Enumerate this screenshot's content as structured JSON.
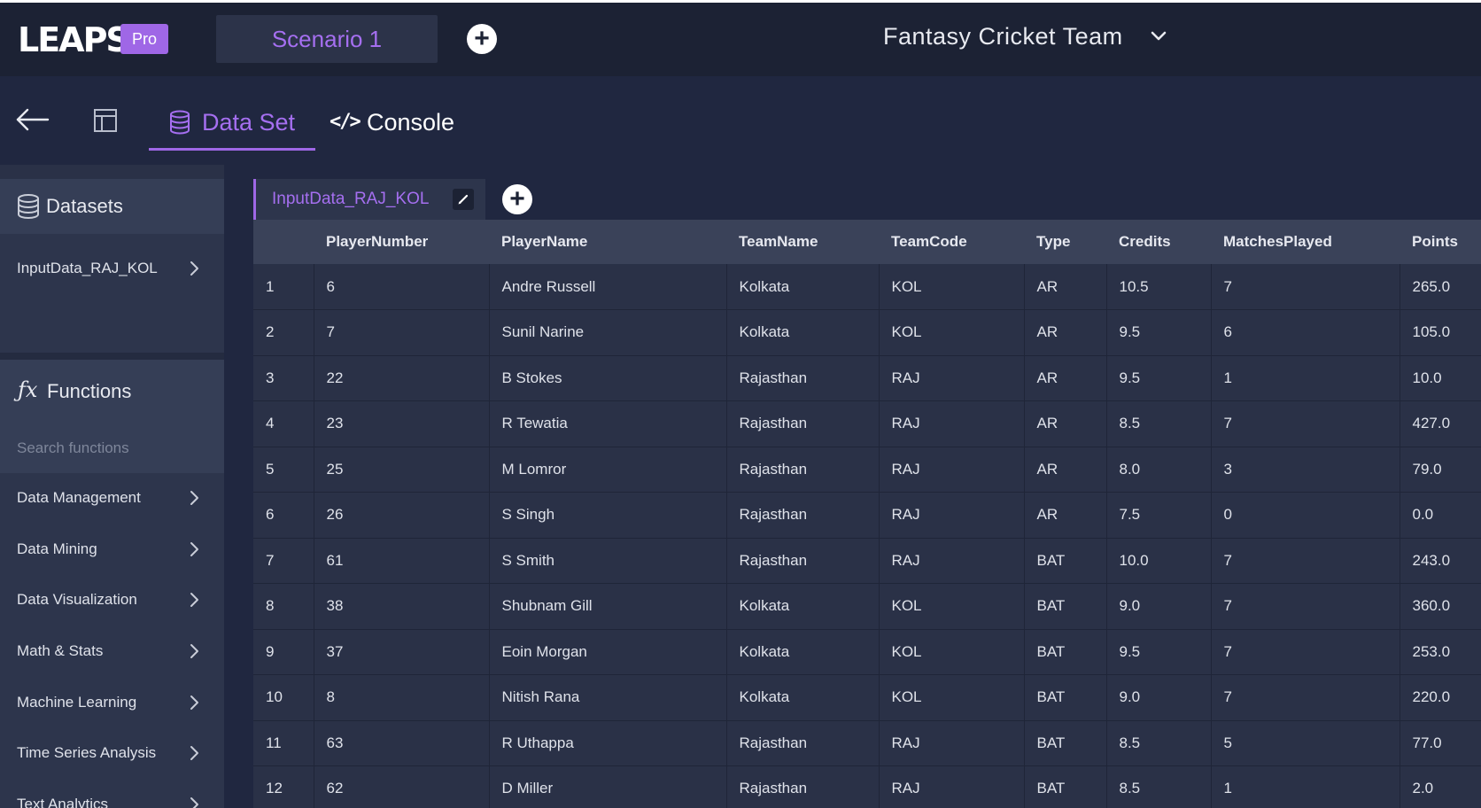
{
  "app": {
    "logo_text": "LEAPS",
    "badge": "Pro",
    "scenario_tab": "Scenario 1",
    "project_title": "Fantasy Cricket Team"
  },
  "nav": {
    "tabs": [
      {
        "label": "Data Set",
        "active": true
      },
      {
        "label": "Console",
        "active": false
      }
    ],
    "console_glyph": "</>"
  },
  "sidebar": {
    "datasets_header": "Datasets",
    "datasets": [
      "InputData_RAJ_KOL"
    ],
    "functions_header": "Functions",
    "search_placeholder": "Search functions",
    "function_groups": [
      "Data Management",
      "Data Mining",
      "Data Visualization",
      "Math & Stats",
      "Machine Learning",
      "Time Series Analysis",
      "Text Analytics"
    ]
  },
  "dataset_tab": {
    "label": "InputData_RAJ_KOL"
  },
  "table": {
    "columns": [
      "",
      "PlayerNumber",
      "PlayerName",
      "TeamName",
      "TeamCode",
      "Type",
      "Credits",
      "MatchesPlayed",
      "Points"
    ],
    "rows": [
      [
        "1",
        "6",
        "Andre Russell",
        "Kolkata",
        "KOL",
        "AR",
        "10.5",
        "7",
        "265.0"
      ],
      [
        "2",
        "7",
        "Sunil Narine",
        "Kolkata",
        "KOL",
        "AR",
        "9.5",
        "6",
        "105.0"
      ],
      [
        "3",
        "22",
        "B Stokes",
        "Rajasthan",
        "RAJ",
        "AR",
        "9.5",
        "1",
        "10.0"
      ],
      [
        "4",
        "23",
        "R Tewatia",
        "Rajasthan",
        "RAJ",
        "AR",
        "8.5",
        "7",
        "427.0"
      ],
      [
        "5",
        "25",
        "M Lomror",
        "Rajasthan",
        "RAJ",
        "AR",
        "8.0",
        "3",
        "79.0"
      ],
      [
        "6",
        "26",
        "S Singh",
        "Rajasthan",
        "RAJ",
        "AR",
        "7.5",
        "0",
        "0.0"
      ],
      [
        "7",
        "61",
        "S Smith",
        "Rajasthan",
        "RAJ",
        "BAT",
        "10.0",
        "7",
        "243.0"
      ],
      [
        "8",
        "38",
        "Shubnam Gill",
        "Kolkata",
        "KOL",
        "BAT",
        "9.0",
        "7",
        "360.0"
      ],
      [
        "9",
        "37",
        "Eoin Morgan",
        "Kolkata",
        "KOL",
        "BAT",
        "9.5",
        "7",
        "253.0"
      ],
      [
        "10",
        "8",
        "Nitish Rana",
        "Kolkata",
        "KOL",
        "BAT",
        "9.0",
        "7",
        "220.0"
      ],
      [
        "11",
        "63",
        "R Uthappa",
        "Rajasthan",
        "RAJ",
        "BAT",
        "8.5",
        "5",
        "77.0"
      ],
      [
        "12",
        "62",
        "D Miller",
        "Rajasthan",
        "RAJ",
        "BAT",
        "8.5",
        "1",
        "2.0"
      ]
    ]
  },
  "colors": {
    "accent": "#9f67e6",
    "background": "#202740",
    "topbar": "#1c2234"
  }
}
